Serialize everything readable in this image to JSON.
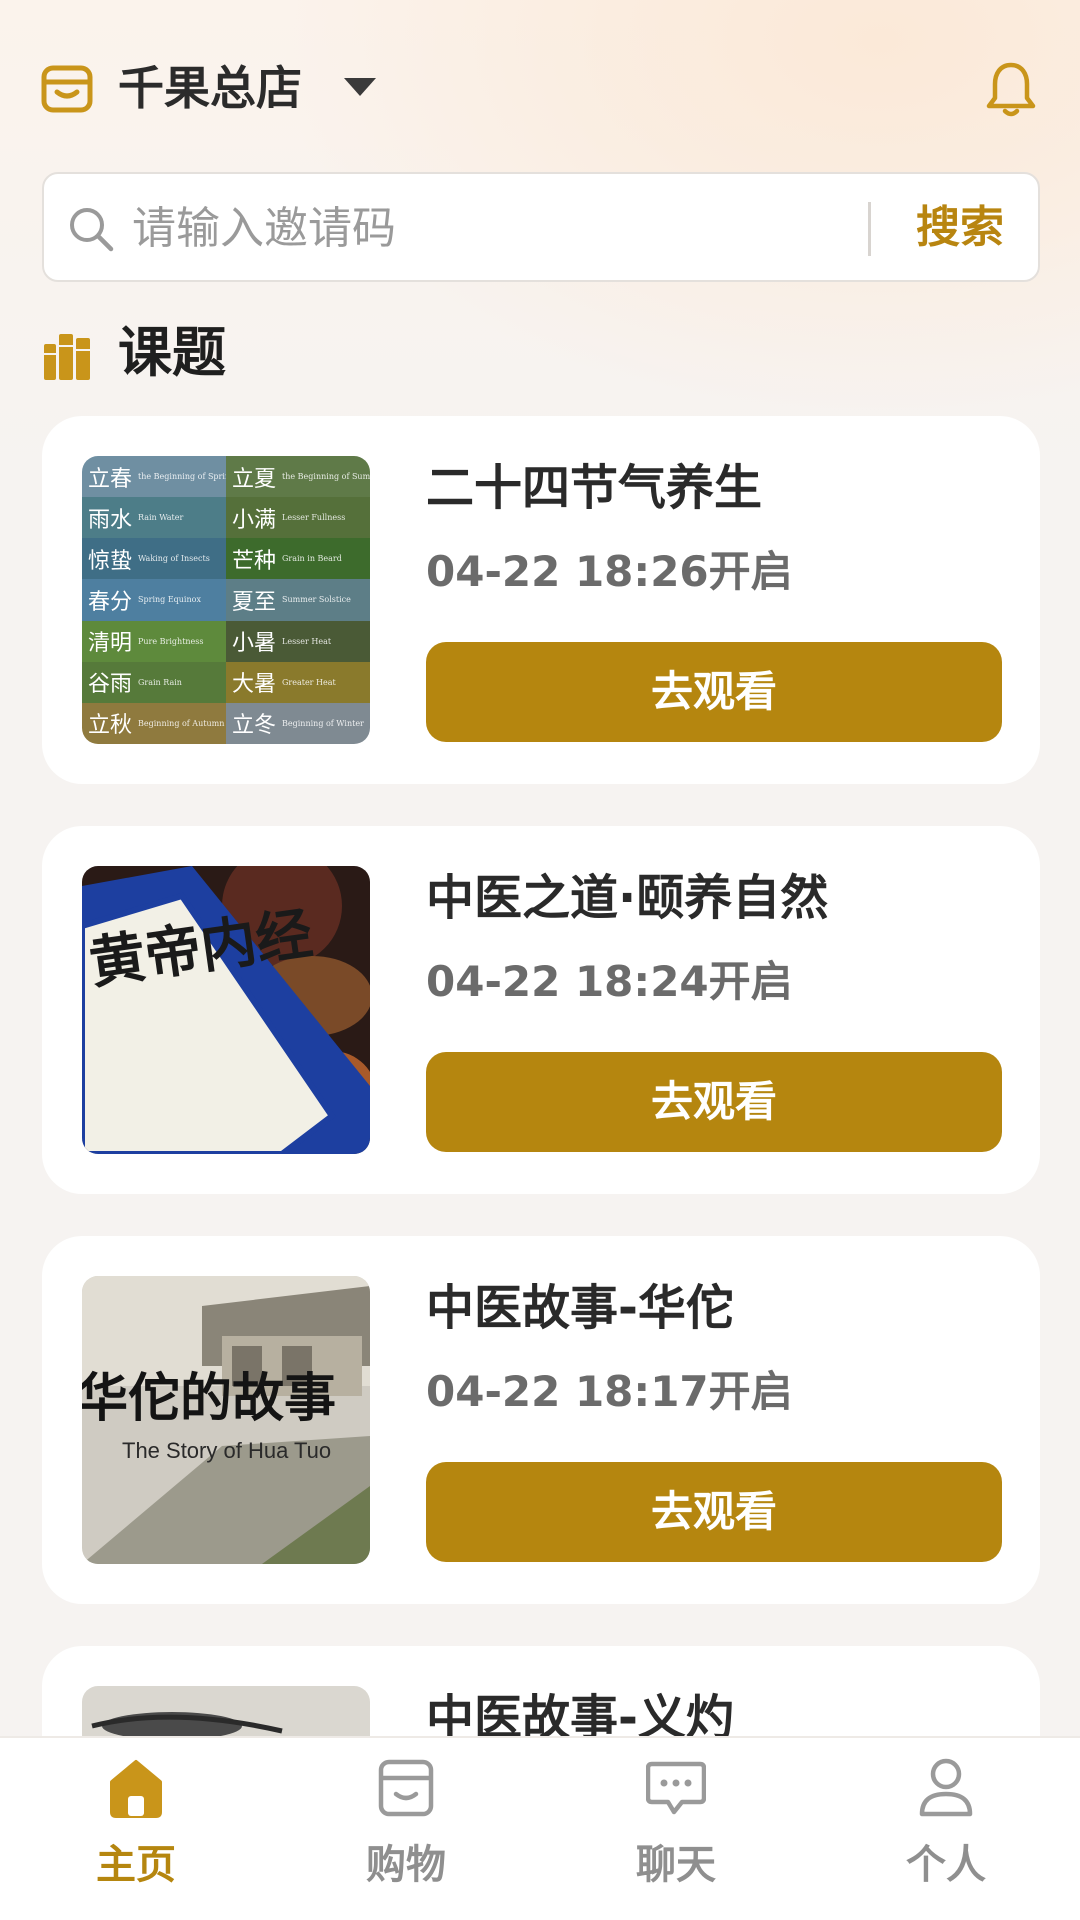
{
  "header": {
    "store_name": "千果总店",
    "colors": {
      "accent": "#b5860f",
      "icon_gold": "#c9951a"
    }
  },
  "search": {
    "placeholder": "请输入邀请码",
    "value": "",
    "button_label": "搜索"
  },
  "section": {
    "title": "课题"
  },
  "courses": [
    {
      "title": "二十四节气养生",
      "time": "04-22 18:26开启",
      "button_label": "去观看",
      "thumb": "solar-terms-collage"
    },
    {
      "title": "中医之道·颐养自然",
      "time": "04-22 18:24开启",
      "button_label": "去观看",
      "thumb": "huangdi-neijing-book",
      "thumb_text": "黄帝内经"
    },
    {
      "title": "中医故事-华佗",
      "time": "04-22 18:17开启",
      "button_label": "去观看",
      "thumb": "hua-tuo-story",
      "thumb_text": "华佗的故事",
      "thumb_subtext": "The Story of Hua Tuo"
    },
    {
      "title": "中医故事-义灼",
      "thumb": "ink-painting"
    }
  ],
  "solar_terms": [
    "立春",
    "立夏",
    "雨水",
    "小满",
    "惊蛰",
    "芒种",
    "春分",
    "夏至",
    "清明",
    "小暑",
    "谷雨",
    "大暑",
    "立秋",
    "立冬"
  ],
  "tabbar": {
    "items": [
      {
        "label": "主页",
        "icon": "home-icon",
        "active": true
      },
      {
        "label": "购物",
        "icon": "shop-icon",
        "active": false
      },
      {
        "label": "聊天",
        "icon": "chat-icon",
        "active": false
      },
      {
        "label": "个人",
        "icon": "person-icon",
        "active": false
      }
    ]
  }
}
